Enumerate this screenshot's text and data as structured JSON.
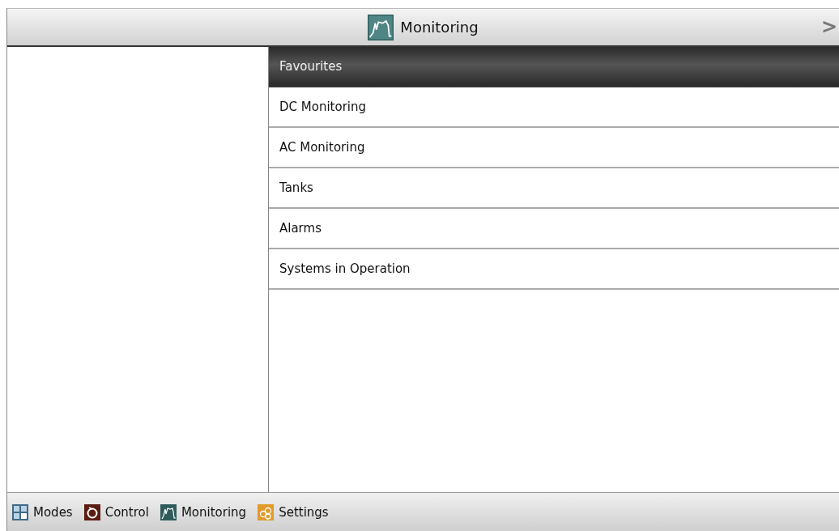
{
  "header": {
    "title": "Monitoring",
    "next": ">"
  },
  "menu": [
    {
      "label": "Favourites",
      "selected": true
    },
    {
      "label": "DC Monitoring",
      "selected": false
    },
    {
      "label": "AC Monitoring",
      "selected": false
    },
    {
      "label": "Tanks",
      "selected": false
    },
    {
      "label": "Alarms",
      "selected": false
    },
    {
      "label": "Systems in Operation",
      "selected": false
    }
  ],
  "nav": [
    {
      "label": "Modes",
      "kind": "modes"
    },
    {
      "label": "Control",
      "kind": "control"
    },
    {
      "label": "Monitoring",
      "kind": "monitoring"
    },
    {
      "label": "Settings",
      "kind": "settings"
    }
  ]
}
